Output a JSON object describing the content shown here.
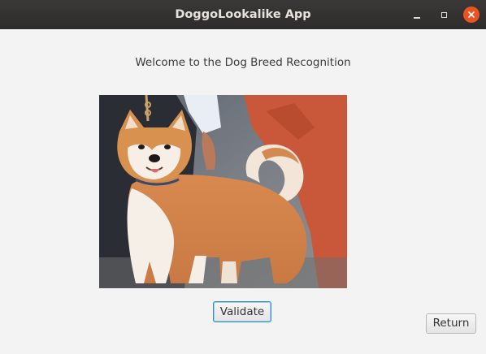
{
  "window": {
    "title": "DoggoLookalike App",
    "controls": {
      "minimize_icon": "minimize-icon",
      "maximize_icon": "maximize-icon",
      "close_icon": "close-icon",
      "close_color": "#e95420"
    }
  },
  "main": {
    "welcome_text": "Welcome to the Dog Breed Recognition",
    "image_alt": "Akita dog photo",
    "validate_label": "Validate",
    "return_label": "Return"
  }
}
